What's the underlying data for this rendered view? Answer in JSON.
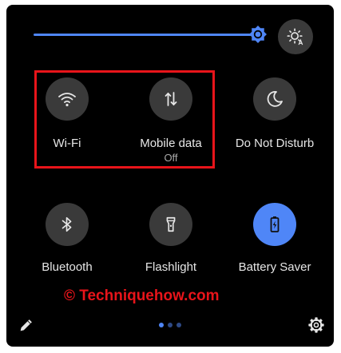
{
  "colors": {
    "accent": "#4f86f7",
    "tile_inactive": "#3a3a3a",
    "highlight_border": "#e8141a",
    "panel_bg": "#000000"
  },
  "brightness": {
    "level": 0.95,
    "slider_icon": "sun-icon",
    "auto_icon": "auto-brightness-icon"
  },
  "tiles": [
    {
      "label": "Wi-Fi",
      "state": "",
      "icon": "wifi-icon",
      "active": false
    },
    {
      "label": "Mobile data",
      "state": "Off",
      "icon": "mobile-data-icon",
      "active": false
    },
    {
      "label": "Do Not Disturb",
      "state": "",
      "icon": "moon-icon",
      "active": false
    },
    {
      "label": "Bluetooth",
      "state": "",
      "icon": "bluetooth-icon",
      "active": false
    },
    {
      "label": "Flashlight",
      "state": "",
      "icon": "flashlight-icon",
      "active": false
    },
    {
      "label": "Battery Saver",
      "state": "",
      "icon": "battery-saver-icon",
      "active": true
    }
  ],
  "footer": {
    "edit_icon": "pencil-icon",
    "settings_icon": "gear-icon",
    "pages": 3,
    "current_page": 1
  },
  "watermark": "© Techniquehow.com"
}
